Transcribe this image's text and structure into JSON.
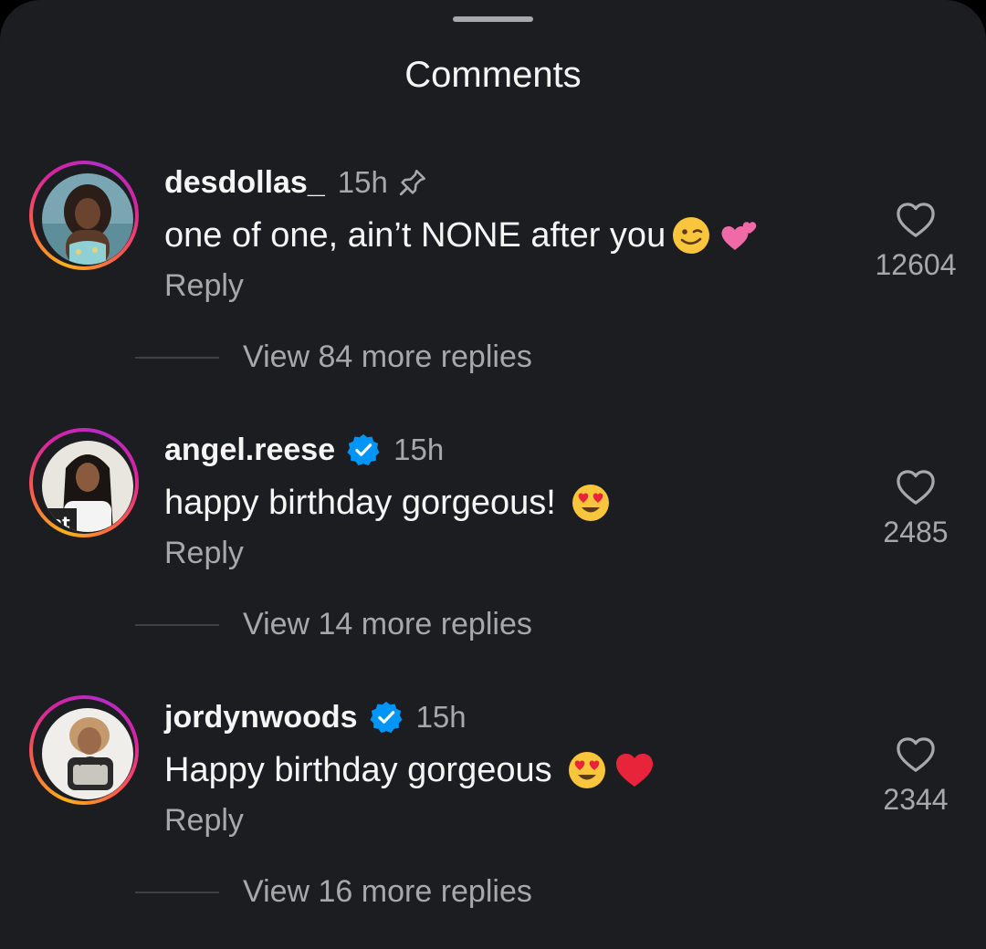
{
  "sheet": {
    "title": "Comments"
  },
  "comments": [
    {
      "username": "desdollas_",
      "verified": false,
      "time": "15h",
      "pinned": true,
      "text": "one of one, ain’t NONE after you",
      "emojis": [
        "wink-emoji",
        "two-hearts-emoji"
      ],
      "reply_label": "Reply",
      "likes": "12604",
      "view_replies": "View 84 more replies"
    },
    {
      "username": "angel.reese",
      "verified": true,
      "time": "15h",
      "pinned": false,
      "text": "happy birthday gorgeous! ",
      "emojis": [
        "heart-eyes-emoji"
      ],
      "reply_label": "Reply",
      "likes": "2485",
      "view_replies": "View 14 more replies"
    },
    {
      "username": "jordynwoods",
      "verified": true,
      "time": "15h",
      "pinned": false,
      "text": "Happy birthday gorgeous ",
      "emojis": [
        "heart-eyes-emoji",
        "red-heart-emoji"
      ],
      "reply_label": "Reply",
      "likes": "2344",
      "view_replies": "View 16 more replies"
    }
  ],
  "colors": {
    "background": "#1c1d21",
    "text_primary": "#f5f5f5",
    "text_secondary": "#a6a8ad",
    "verified_blue": "#0095f6",
    "story_ring": [
      "#f7b21b",
      "#fd5949",
      "#d6249f"
    ]
  }
}
